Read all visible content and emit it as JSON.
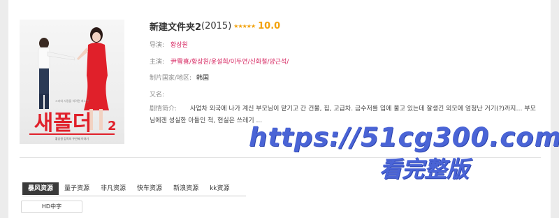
{
  "movie": {
    "name": "新建文件夹2",
    "year": "(2015)",
    "stars": "★★★★★",
    "score": "10.0"
  },
  "fields": {
    "director_label": "导演:",
    "director": "황상원",
    "cast_label": "主演:",
    "cast": "尹雪喜/황상원/윤설희/이두연/신화철/양근석/",
    "region_label": "制片国家/地区:",
    "region": "韩国",
    "alias_label": "又名:",
    "alias": "",
    "synopsis_label": "剧情简介:",
    "synopsis": "사업차 외국에 나가 계신 부모님이 맡기고 간 건물, 집, 고급차. 금수저를 입에 물고 있는데 잘생긴 외모에 엄청난 거기(?)까지… 부모님에겐 성실한 아들인 척, 현실은 쓰레기 ..."
  },
  "poster": {
    "title_text": "새폴더",
    "number": "2",
    "tagline": "그녀와 사랑을 하려면 최소한",
    "credits": "황상원 감독의 두번째 이야기"
  },
  "tabs": [
    {
      "label": "暴风资源",
      "active": true
    },
    {
      "label": "量子资源",
      "active": false
    },
    {
      "label": "非凡资源",
      "active": false
    },
    {
      "label": "快车资源",
      "active": false
    },
    {
      "label": "新浪资源",
      "active": false
    },
    {
      "label": "kk资源",
      "active": false
    }
  ],
  "quality_button": "HD中字",
  "watermark": {
    "url": "https://51cg300.com",
    "sub": "看完整版",
    "color": "#4a64d6"
  },
  "colors": {
    "accent_pink": "#d6245f",
    "score_orange": "#f2a20c",
    "poster_red": "#e0202a"
  }
}
